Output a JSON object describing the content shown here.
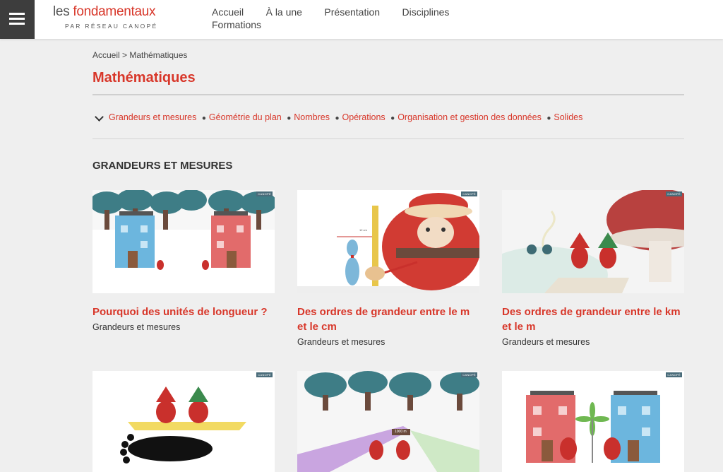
{
  "header": {
    "logo_prefix": "les ",
    "logo_brand": "fondamentaux",
    "logo_tagline": "PAR RÉSEAU CANOPÉ",
    "nav": [
      "Accueil",
      "À la une",
      "Présentation",
      "Disciplines",
      "Formations"
    ]
  },
  "breadcrumb": "Accueil > Mathématiques",
  "page_title": "Mathématiques",
  "filters": [
    "Grandeurs et mesures",
    "Géométrie du plan",
    "Nombres",
    "Opérations",
    "Organisation et gestion des données",
    "Solides"
  ],
  "section_title": "GRANDEURS ET MESURES",
  "cards": [
    {
      "title": "Pourquoi des unités de longueur ?",
      "category": "Grandeurs et mesures",
      "badge": "CANOPÉ"
    },
    {
      "title": "Des ordres de grandeur entre le m et le cm",
      "category": "Grandeurs et mesures",
      "badge": "CANOPÉ",
      "ruler_label": "12 cm"
    },
    {
      "title": "Des ordres de grandeur entre le km et le m",
      "category": "Grandeurs et mesures",
      "badge": "CANOPÉ"
    },
    {
      "badge": "CANOPÉ"
    },
    {
      "badge": "CANOPÉ",
      "sign_label": "1000 m"
    },
    {
      "badge": "CANOPÉ"
    }
  ],
  "colors": {
    "accent": "#d8372a",
    "menu": "#3d3d3d",
    "background": "#efefef"
  }
}
